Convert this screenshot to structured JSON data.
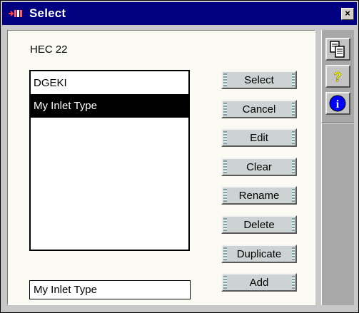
{
  "window": {
    "title": "Select",
    "close_glyph": "×"
  },
  "dialog": {
    "category_label": "HEC 22",
    "list_items": [
      "DGEKI",
      "My Inlet Type"
    ],
    "selected_index": 1,
    "name_field_value": "My Inlet Type"
  },
  "buttons": {
    "select": "Select",
    "cancel": "Cancel",
    "edit": "Edit",
    "clear": "Clear",
    "rename": "Rename",
    "delete": "Delete",
    "duplicate": "Duplicate",
    "add": "Add"
  },
  "toolbar": {
    "icons": [
      "copy-icon",
      "help-icon",
      "info-icon"
    ],
    "help_glyph": "?",
    "info_glyph": "i"
  },
  "colors": {
    "titlebar": "#000080",
    "selection": "#000000",
    "info_blue": "#0000ff",
    "help_yellow": "#ffff00"
  }
}
